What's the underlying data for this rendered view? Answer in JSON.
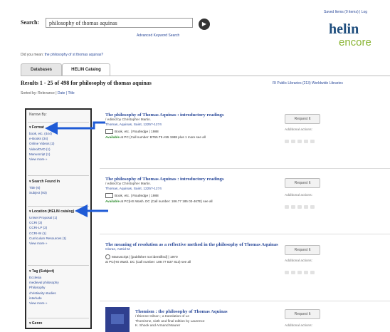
{
  "top_links": "Saved Items (0 items)  |  Log",
  "search": {
    "label": "Search:",
    "value": "philosophy of thomas aquinas",
    "go_label": "▶",
    "advanced_link": "Advanced Keyword Search"
  },
  "logo": {
    "helin": "helin",
    "encore": "encore"
  },
  "did_you_mean": {
    "prefix": "Did you mean:",
    "suggestion": "the philosophy of st thomas aquinas?"
  },
  "tabs": [
    "Databases",
    "HELIN Catalog"
  ],
  "results": {
    "title": "Results 1 - 25 of 498 for philosophy of thomas aquinas",
    "right_label": "RI Public Libraries (213)   Worldwide Libraries",
    "sort_prefix": "Sorted by: Relevance |",
    "sort_options": "Date | Title"
  },
  "sidebar": {
    "header": "Narrow By:",
    "sections": [
      {
        "heading": "Format",
        "items": [
          "book, etc. (444)",
          "e-Books (34)",
          "Online Videos (2)",
          "Video/DVD (1)",
          "Manuscript (1)",
          "View more »"
        ]
      },
      {
        "heading": "Search Found In",
        "items": [
          "Title (6)",
          "Subject (93)"
        ]
      },
      {
        "heading": "Location (HELIN catalog)",
        "items": [
          "Uniset Proposal (1)",
          "CCRI (3)",
          "CCRI-LP (2)",
          "CCRI-W (1)",
          "Curriculum Resources (1)",
          "View more »"
        ]
      },
      {
        "heading": "Tag (Subject)",
        "items": [
          "Ecclesia",
          "medieval philosophy",
          "Philosophy",
          "christianity studies",
          "interlude",
          "View more »"
        ]
      },
      {
        "heading": "Genre",
        "items": []
      }
    ]
  },
  "result_items": [
    {
      "title": "The philosophy of Thomas Aquinas : introductory readings",
      "meta": [
        "/ edited by Christopher Martin.",
        "Thomas, Aquinas, Saint, 1225?-1274"
      ],
      "format": "Book, etc.  |  Routledge  |  1988",
      "availability_label": "Available",
      "availability": " at PC (Call number: B765.T5 A55 1988 plus 1 more  see all",
      "request_label": "Request It",
      "additional": "Additional actions:"
    },
    {
      "title": "The philosophy of Thomas Aquinas : introductory readings",
      "meta": [
        "/ edited by Christopher Martin.",
        "Thomas, Aquinas, Saint, 1225?-1274"
      ],
      "format": "Book, etc.  |  Routledge  |  1988",
      "availability_label": "Available",
      "availability": " at PC(HS Wash. DC (Call number: 186.77 185 03-467E)  see all",
      "request_label": "Request It",
      "additional": "Additional actions:"
    },
    {
      "title": "The meaning of resolution as a reflective method in the philosophy of Thomas Aquinas",
      "meta": [
        "/ by Astrid M. O'Brien",
        "Cloran, Astrid M."
      ],
      "format": "Manuscript  |  [publisher not identified]  |  1970",
      "availability_label": "",
      "availability": "at PC(HS Wash. DC (Call number: 189.77 B37 813) see all",
      "request_label": "Request It",
      "additional": "Additional actions:"
    },
    {
      "title": "Thomism : the philosophy of Thomas Aquinas",
      "meta": [
        "/ Étienne Gilson ; a translation of Le",
        "Thomisme, sixth and final edition by Laurence",
        "K. Shook and Armand Maurer"
      ],
      "format": "",
      "availability_label": "",
      "availability": "",
      "request_label": "Request It",
      "additional": "Additional actions:"
    }
  ],
  "colors": {
    "link": "#2b4a9a",
    "arrow": "#1f5bd6",
    "available": "#2a8a2a",
    "logo_blue": "#1f4e7e",
    "logo_green": "#8ab534"
  }
}
